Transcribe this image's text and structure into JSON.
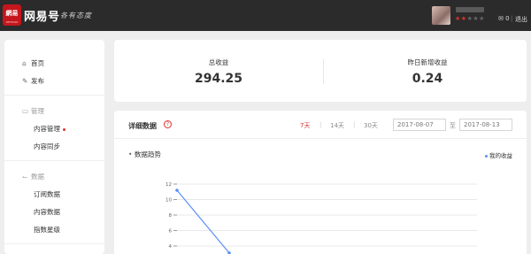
{
  "header": {
    "logo_text": "網易",
    "logo_sub": "NETEASE",
    "brand": "网易号",
    "slogan": "各有态度",
    "user_rating": 2,
    "user_rating_max": 5,
    "messages": "0",
    "logout": "退出"
  },
  "sidebar": {
    "home": "首页",
    "publish": "发布",
    "group_manage": "管理",
    "content_manage": "内容管理",
    "content_sync": "内容同步",
    "group_data": "数据",
    "subscribe_data": "订阅数据",
    "content_data": "内容数据",
    "index_level": "指数星级"
  },
  "summary": {
    "total_label": "总收益",
    "total_value": "294.25",
    "yesterday_label": "昨日新增收益",
    "yesterday_value": "0.24"
  },
  "detail": {
    "title": "详细数据",
    "help": "?",
    "range_7": "7天",
    "range_14": "14天",
    "range_30": "30天",
    "date_from": "2017-08-07",
    "to": "至",
    "date_to": "2017-08-13",
    "trend_label": "数据趋势",
    "legend": "我的收益"
  },
  "chart_data": {
    "type": "line",
    "title": "",
    "xlabel": "",
    "ylabel": "",
    "ylim": [
      0,
      12
    ],
    "yticks": [
      "12",
      "10",
      "8",
      "6",
      "4"
    ],
    "series": [
      {
        "name": "我的收益",
        "color": "#5b8ff9",
        "x": [
          0,
          1
        ],
        "values": [
          11.2,
          3.1
        ]
      }
    ]
  }
}
